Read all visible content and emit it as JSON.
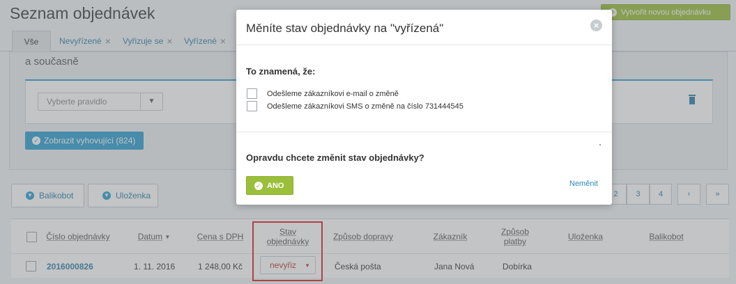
{
  "page": {
    "title": "Seznam objednávek",
    "create_button": "Vytvořit novou objednávku"
  },
  "tabs": [
    {
      "label": "Vše"
    },
    {
      "label": "Nevyřízené"
    },
    {
      "label": "Vyřizuje se"
    },
    {
      "label": "Vyřízené"
    }
  ],
  "tab_close_glyph": "×",
  "filter": {
    "subtitle": "a současně",
    "rule_placeholder": "Vyberte pravidlo",
    "rule_chevron": "▼",
    "show_button": "Zobrazit vyhovující (824)",
    "check_glyph": "✓"
  },
  "shipping_buttons": [
    {
      "label": "Balikobot"
    },
    {
      "label": "Uloženka"
    }
  ],
  "pagination": [
    "2",
    "3",
    "4",
    "›",
    "»"
  ],
  "table": {
    "headers": [
      "Číslo objednávky",
      "Datum",
      "Cena s DPH",
      "Stav objednávky",
      "Způsob dopravy",
      "Zákazník",
      "Způsob platby",
      "Uloženka",
      "Balikobot"
    ],
    "sort_indicator": "▼",
    "rows": [
      {
        "order_number": "2016000826",
        "date": "1. 11. 2016",
        "price": "1 248,00 Kč",
        "status": "nevyřiz",
        "shipping": "Česká pošta",
        "customer": "Jana Nová",
        "payment": "Dobírka"
      }
    ]
  },
  "modal": {
    "title": "Měníte stav objednávky na \"vyřízená\"",
    "close_glyph": "×",
    "subtitle": "To znamená, že:",
    "options": [
      {
        "label": "Odešleme zákazníkovi e-mail o změně"
      },
      {
        "label": "Odešleme zákazníkovi SMS o změně na číslo 731444545"
      }
    ],
    "question": "Opravdu chcete změnit stav objednávky?",
    "confirm": "ANO",
    "cancel": "Neměnit"
  },
  "colors": {
    "accent_blue": "#2b9fd0",
    "accent_green": "#9bbf3a",
    "highlight_red": "#e02020"
  }
}
